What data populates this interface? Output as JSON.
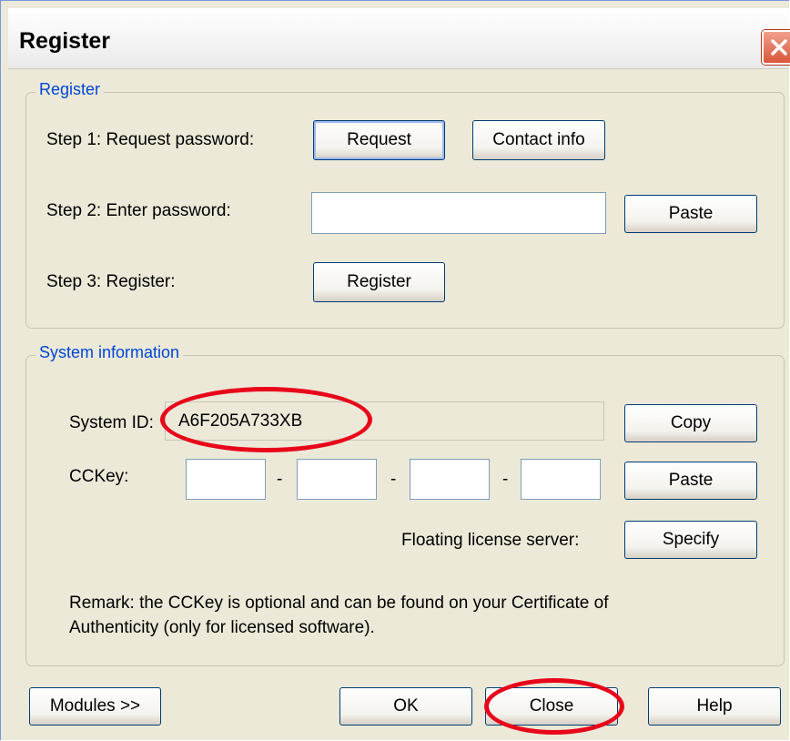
{
  "window": {
    "title": "Register",
    "close_glyph": "✕"
  },
  "register_group": {
    "legend": "Register",
    "step1_label": "Step 1: Request password:",
    "request_button": "Request",
    "contact_button": "Contact info",
    "step2_label": "Step 2: Enter password:",
    "password_value": "",
    "paste_button": "Paste",
    "step3_label": "Step 3: Register:",
    "register_button": "Register"
  },
  "system_group": {
    "legend": "System information",
    "system_id_label": "System ID:",
    "system_id_value": "A6F205A733XB",
    "copy_button": "Copy",
    "cckey_label": "CCKey:",
    "cckey_values": [
      "",
      "",
      "",
      ""
    ],
    "dash": "-",
    "paste_button": "Paste",
    "floating_label": "Floating license server:",
    "specify_button": "Specify",
    "remark_line1": "Remark: the CCKey is optional and can be found on your Certificate of",
    "remark_line2": "Authenticity (only for licensed software)."
  },
  "footer": {
    "modules_button": "Modules >>",
    "ok_button": "OK",
    "close_button": "Close",
    "help_button": "Help"
  },
  "colors": {
    "annotation": "#E8061A",
    "legend": "#0046D5",
    "dialog_bg": "#ECE9D8"
  }
}
